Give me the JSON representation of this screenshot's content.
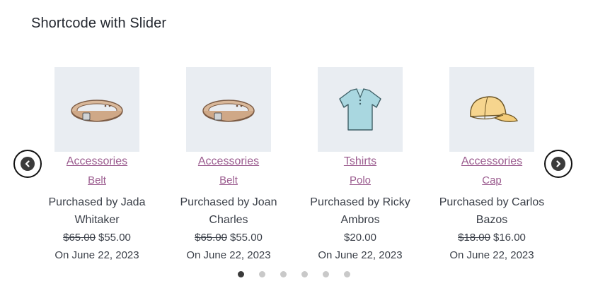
{
  "header": {
    "title": "Shortcode with Slider"
  },
  "slider": {
    "prev_icon": "chevron-left-icon",
    "next_icon": "chevron-right-icon",
    "items": [
      {
        "category": "Accessories",
        "product": "Belt",
        "buyer": "Purchased by Jada Whitaker",
        "old_price": "$65.00",
        "price": "$55.00",
        "date": "On June 22, 2023",
        "icon": "belt-icon"
      },
      {
        "category": "Accessories",
        "product": "Belt",
        "buyer": "Purchased by Joan Charles",
        "old_price": "$65.00",
        "price": "$55.00",
        "date": "On June 22, 2023",
        "icon": "belt-icon"
      },
      {
        "category": "Tshirts",
        "product": "Polo",
        "buyer": "Purchased by Ricky Ambros",
        "old_price": "",
        "price": "$20.00",
        "date": "On June 22, 2023",
        "icon": "polo-shirt-icon"
      },
      {
        "category": "Accessories",
        "product": "Cap",
        "buyer": "Purchased by Carlos Bazos",
        "old_price": "$18.00",
        "price": "$16.00",
        "date": "On June 22, 2023",
        "icon": "cap-icon"
      }
    ],
    "dots": {
      "count": 6,
      "active_index": 0
    }
  },
  "colors": {
    "link": "#9b5c8f",
    "thumb_bg": "#e9edf2",
    "dot_active": "#3a3a3a",
    "dot_inactive": "#c9c9c9"
  }
}
